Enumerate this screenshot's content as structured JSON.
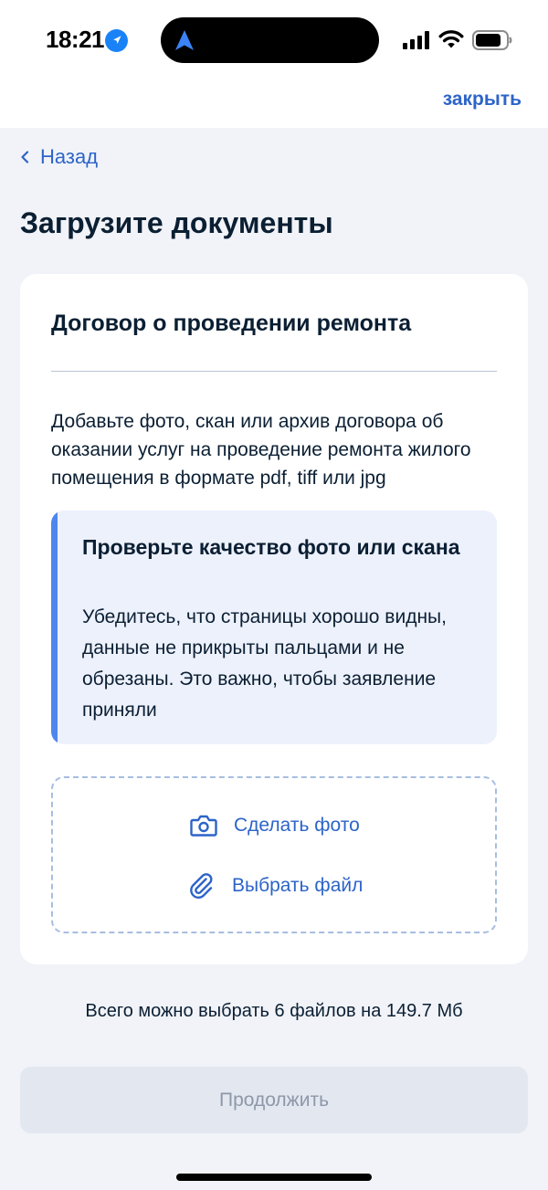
{
  "status_bar": {
    "time": "18:21"
  },
  "header": {
    "close_label": "закрыть",
    "back_label": "Назад"
  },
  "page": {
    "title": "Загрузите документы"
  },
  "card": {
    "title": "Договор о проведении ремонта",
    "description": "Добавьте фото, скан или архив договора об оказании услуг на проведение ремонта жилого помещения в формате pdf, tiff или jpg",
    "notice": {
      "title": "Проверьте качество фото или скана",
      "text": "Убедитесь, что страницы хорошо видны, данные не прикрыты пальцами и не обрезаны. Это важно, чтобы заявление приняли"
    },
    "upload": {
      "photo_label": "Сделать фото",
      "file_label": "Выбрать файл"
    }
  },
  "limit_text": "Всего можно выбрать 6 файлов на 149.7 Мб",
  "continue_label": "Продолжить",
  "colors": {
    "accent": "#2d64c8",
    "notice_bar": "#4f86ee",
    "notice_bg": "#edf1fc",
    "disabled_button_bg": "#e3e7f0",
    "disabled_button_text": "#8d98a8"
  },
  "icons": {
    "location": "location-arrow-icon",
    "signal": "cellular-signal-icon",
    "wifi": "wifi-icon",
    "battery": "battery-icon",
    "back": "chevron-left-icon",
    "camera": "camera-icon",
    "attach": "paperclip-icon"
  }
}
